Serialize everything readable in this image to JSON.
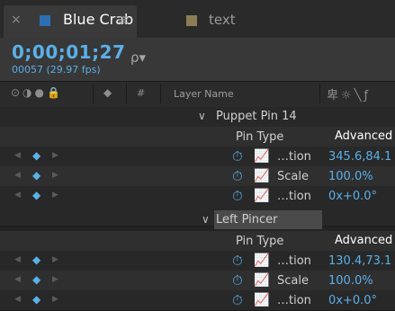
{
  "tabs": [
    {
      "label": "Blue Crab",
      "active": true,
      "swatch_color": "#2c6fb4",
      "close_icon": "×",
      "menu_icon": "≡"
    },
    {
      "label": "text",
      "active": false,
      "swatch_color": "#8c7d57"
    }
  ],
  "timecode": "0;00;01;27",
  "frame_info": "00057 (29.97 fps)",
  "search": {
    "icon": "ρ▾",
    "placeholder": ""
  },
  "columns": {
    "switch_icons": "⊙◑●🔒",
    "label_icon": "◆",
    "number": "#",
    "layer_name": "Layer Name",
    "right_icons": "卑☼╲ƒ"
  },
  "groups": [
    {
      "caret": "∨",
      "name": "Puppet Pin 14",
      "pin_type_label": "Pin Type",
      "pin_type_value": "Advanced",
      "properties": [
        {
          "name": "…tion",
          "value": "345.6,84.1"
        },
        {
          "name": "Scale",
          "value": "100.0%"
        },
        {
          "name": "…tion",
          "value": "0x+0.0°"
        }
      ]
    },
    {
      "caret": "∨",
      "name": "Left Pincer",
      "pin_type_label": "Pin Type",
      "pin_type_value": "Advanced",
      "properties": [
        {
          "name": "…tion",
          "value": "130.4,73.1"
        },
        {
          "name": "Scale",
          "value": "100.0%"
        },
        {
          "name": "…tion",
          "value": "0x+0.0°"
        }
      ]
    }
  ],
  "keyframe_glyphs": {
    "prev": "◀",
    "diamond": "◆",
    "next": "▶",
    "stopwatch": "⏱",
    "graph": "📈"
  },
  "colors": {
    "accent": "#5ab0e8",
    "background": "#232323"
  }
}
